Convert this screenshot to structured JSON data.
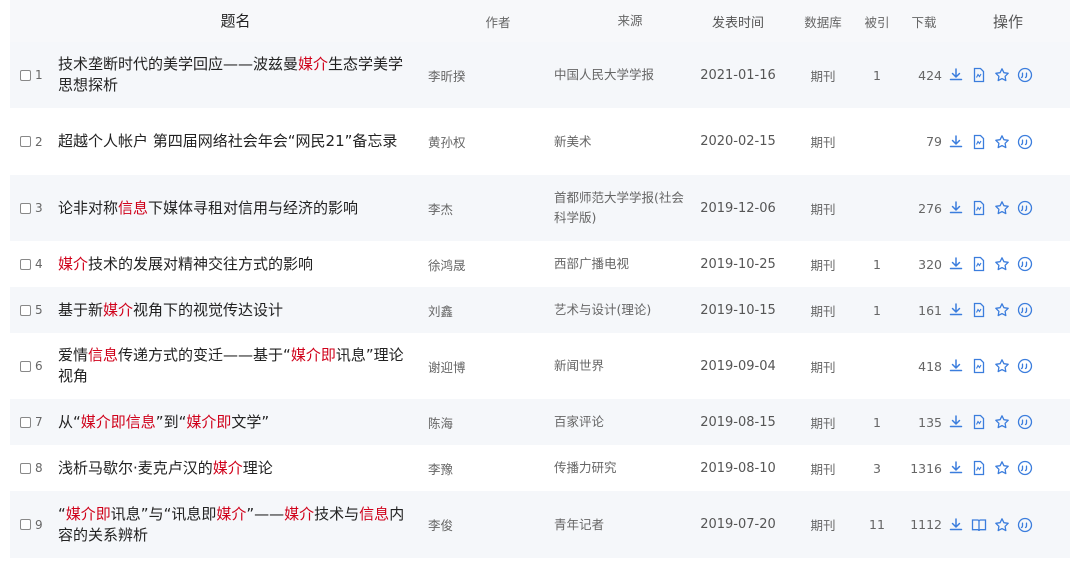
{
  "header": {
    "title": "题名",
    "author": "作者",
    "source": "来源",
    "date": "发表时间",
    "db": "数据库",
    "cited": "被引",
    "downloads": "下载",
    "ops": "操作"
  },
  "colors": {
    "highlight": "#d0021b",
    "icon": "#3b7ddd",
    "row_alt": "#f5f7fa"
  },
  "rows": [
    {
      "num": "1",
      "title": [
        {
          "t": "技术垄断时代的美学回应——波兹曼"
        },
        {
          "t": "媒介",
          "hl": true
        },
        {
          "t": "生态学美学思想探析"
        }
      ],
      "author": "李昕揆",
      "source": "中国人民大学学报",
      "date": "2021-01-16",
      "db": "期刊",
      "cited": "1",
      "downloads": "424",
      "view_icon": "pdf-icon"
    },
    {
      "num": "2",
      "title": [
        {
          "t": "超越个人帐户 第四届网络社会年会“网民21”备忘录"
        }
      ],
      "author": "黄孙权",
      "source": "新美术",
      "date": "2020-02-15",
      "db": "期刊",
      "cited": "",
      "downloads": "79",
      "view_icon": "pdf-icon"
    },
    {
      "num": "3",
      "title": [
        {
          "t": "论非对称"
        },
        {
          "t": "信息",
          "hl": true
        },
        {
          "t": "下媒体寻租对信用与经济的影响"
        }
      ],
      "author": "李杰",
      "source": "首都师范大学学报(社会科学版)",
      "date": "2019-12-06",
      "db": "期刊",
      "cited": "",
      "downloads": "276",
      "view_icon": "pdf-icon"
    },
    {
      "num": "4",
      "title": [
        {
          "t": "媒介",
          "hl": true
        },
        {
          "t": "技术的发展对精神交往方式的影响"
        }
      ],
      "author": "徐鸿晟",
      "source": "西部广播电视",
      "date": "2019-10-25",
      "db": "期刊",
      "cited": "1",
      "downloads": "320",
      "view_icon": "pdf-icon"
    },
    {
      "num": "5",
      "title": [
        {
          "t": "基于新"
        },
        {
          "t": "媒介",
          "hl": true
        },
        {
          "t": "视角下的视觉传达设计"
        }
      ],
      "author": "刘鑫",
      "source": "艺术与设计(理论)",
      "date": "2019-10-15",
      "db": "期刊",
      "cited": "1",
      "downloads": "161",
      "view_icon": "pdf-icon"
    },
    {
      "num": "6",
      "title": [
        {
          "t": "爱情"
        },
        {
          "t": "信息",
          "hl": true
        },
        {
          "t": "传递方式的变迁——基于“"
        },
        {
          "t": "媒介即",
          "hl": true
        },
        {
          "t": "讯息”理论视角"
        }
      ],
      "author": "谢迎博",
      "source": "新闻世界",
      "date": "2019-09-04",
      "db": "期刊",
      "cited": "",
      "downloads": "418",
      "view_icon": "pdf-icon"
    },
    {
      "num": "7",
      "title": [
        {
          "t": "从“"
        },
        {
          "t": "媒介即信息",
          "hl": true
        },
        {
          "t": "”到“"
        },
        {
          "t": "媒介即",
          "hl": true
        },
        {
          "t": "文学”"
        }
      ],
      "author": "陈海",
      "source": "百家评论",
      "date": "2019-08-15",
      "db": "期刊",
      "cited": "1",
      "downloads": "135",
      "view_icon": "pdf-icon"
    },
    {
      "num": "8",
      "title": [
        {
          "t": "浅析马歇尔·麦克卢汉的"
        },
        {
          "t": "媒介",
          "hl": true
        },
        {
          "t": "理论"
        }
      ],
      "author": "李豫",
      "source": "传播力研究",
      "date": "2019-08-10",
      "db": "期刊",
      "cited": "3",
      "downloads": "1316",
      "view_icon": "pdf-icon"
    },
    {
      "num": "9",
      "title": [
        {
          "t": "“"
        },
        {
          "t": "媒介即",
          "hl": true
        },
        {
          "t": "讯息”与“讯息即"
        },
        {
          "t": "媒介",
          "hl": true
        },
        {
          "t": "”——"
        },
        {
          "t": "媒介",
          "hl": true
        },
        {
          "t": "技术与"
        },
        {
          "t": "信息",
          "hl": true
        },
        {
          "t": "内容的关系辨析"
        }
      ],
      "author": "李俊",
      "source": "青年记者",
      "date": "2019-07-20",
      "db": "期刊",
      "cited": "11",
      "downloads": "1112",
      "view_icon": "book-icon"
    }
  ]
}
